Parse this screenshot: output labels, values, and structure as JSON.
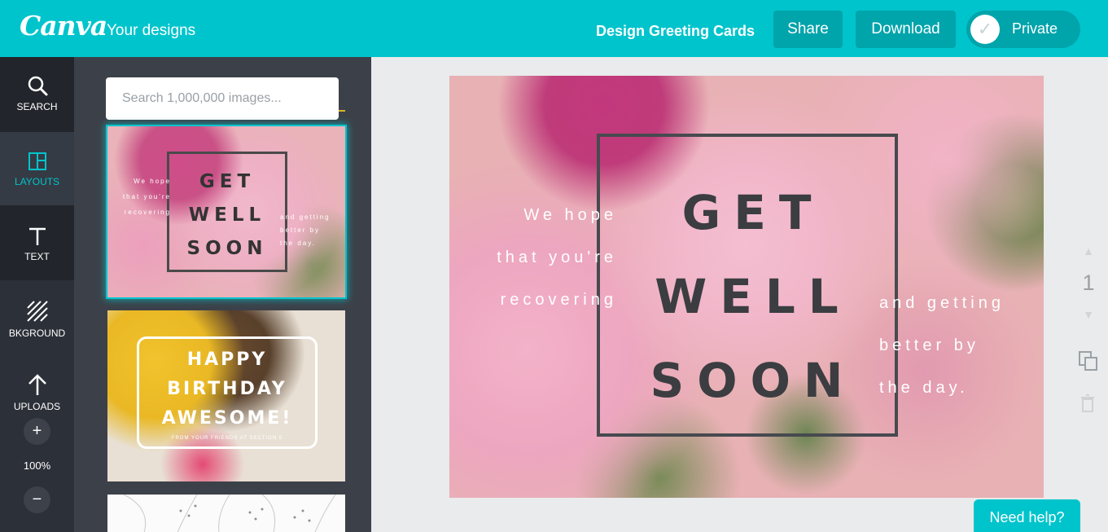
{
  "app": {
    "logo": "Canva",
    "your_designs": "Your designs",
    "doc_title": "Design Greeting Cards"
  },
  "toolbar": {
    "share_label": "Share",
    "download_label": "Download",
    "private_label": "Private"
  },
  "nav": {
    "items": [
      {
        "label": "SEARCH",
        "icon": "search-icon"
      },
      {
        "label": "LAYOUTS",
        "icon": "layouts-icon"
      },
      {
        "label": "TEXT",
        "icon": "text-icon"
      },
      {
        "label": "BKGROUND",
        "icon": "background-icon"
      },
      {
        "label": "UPLOADS",
        "icon": "upload-icon"
      }
    ],
    "zoom_in": "+",
    "zoom_out": "−",
    "zoom_level": "100%"
  },
  "panel": {
    "search_placeholder": "Search 1,000,000 images...",
    "layouts": [
      {
        "title": "GET\nWELL\nSOON",
        "left_text": "We hope\nthat you're\nrecovering",
        "right_text": "and getting\nbetter by\nthe day."
      },
      {
        "title": "HAPPY\nBIRTHDAY\nAWESOME!",
        "subtitle": "FROM YOUR FRIENDS AT SECTION 5"
      }
    ]
  },
  "canvas": {
    "title": "GET\nWELL\nSOON",
    "left_text": "We hope\nthat you're\nrecovering",
    "right_text": "and getting\nbetter by\nthe day."
  },
  "page": {
    "number": "1"
  },
  "help": {
    "label": "Need help?"
  },
  "colors": {
    "accent": "#00c4cc",
    "nav_bg": "#2c3038",
    "panel_bg": "#3c4149"
  }
}
